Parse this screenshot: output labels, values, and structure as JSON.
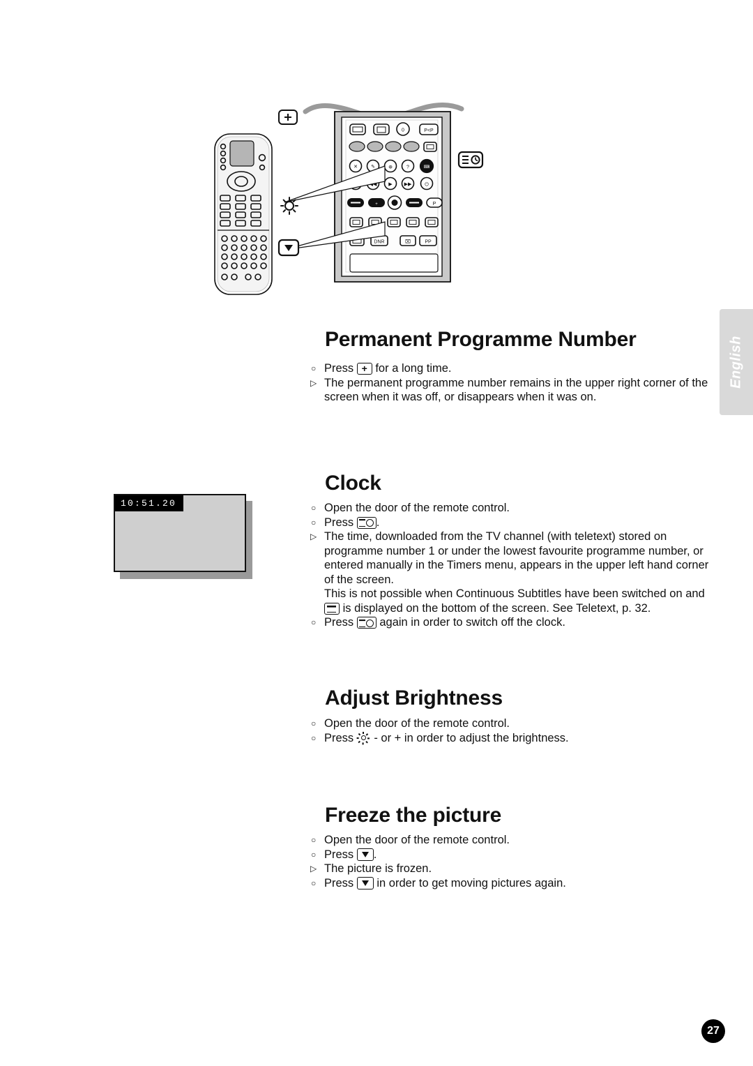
{
  "page": {
    "number": "27",
    "language_tab": "English"
  },
  "illustration": {
    "alt_name": "remote-control-diagram",
    "callouts": {
      "plus_key": "+",
      "brightness_key": "brightness",
      "freeze_key": "freeze",
      "clock_key": "clock"
    },
    "remote_buttons": [
      "P+P",
      "0",
      "DNR",
      "PP",
      "P"
    ]
  },
  "clock_screen": {
    "time": "10:51.20"
  },
  "sections": [
    {
      "id": "permanent-programme-number",
      "title": "Permanent Programme Number",
      "lines": [
        {
          "bullet": "circle",
          "text_before": "Press ",
          "icon": "plus-key",
          "text_after": " for a long time."
        },
        {
          "bullet": "triangle",
          "text_before": "The permanent programme number remains in the upper right corner of the",
          "icon": "",
          "text_after": ""
        },
        {
          "bullet": "none",
          "text_before": "screen when it was off, or disappears when it was on.",
          "icon": "",
          "text_after": ""
        }
      ]
    },
    {
      "id": "clock",
      "title": "Clock",
      "lines": [
        {
          "bullet": "circle",
          "text_before": "Open the door of the remote control.",
          "icon": "",
          "text_after": ""
        },
        {
          "bullet": "circle",
          "text_before": "Press ",
          "icon": "clock-key",
          "text_after": "."
        },
        {
          "bullet": "triangle",
          "text_before": "The time, downloaded from the TV channel (with teletext) stored on",
          "icon": "",
          "text_after": ""
        },
        {
          "bullet": "none",
          "text_before": "programme number 1 or under the lowest favourite programme number, or",
          "icon": "",
          "text_after": ""
        },
        {
          "bullet": "none",
          "text_before": "entered manually in the Timers menu, appears in the upper left hand corner",
          "icon": "",
          "text_after": ""
        },
        {
          "bullet": "none",
          "text_before": "of the screen.",
          "icon": "",
          "text_after": ""
        },
        {
          "bullet": "none",
          "text_before": "This is not possible when Continuous Subtitles have been switched on and",
          "icon": "",
          "text_after": ""
        },
        {
          "bullet": "none",
          "text_before": "",
          "icon": "teletext-key",
          "text_after": " is displayed on the bottom of the screen. See Teletext, p. 32."
        },
        {
          "bullet": "circle",
          "text_before": "Press ",
          "icon": "clock-key",
          "text_after": " again in order to switch off the clock."
        }
      ]
    },
    {
      "id": "adjust-brightness",
      "title": "Adjust Brightness",
      "lines": [
        {
          "bullet": "circle",
          "text_before": "Open the door of the remote control.",
          "icon": "",
          "text_after": ""
        },
        {
          "bullet": "circle",
          "text_before": "Press ",
          "icon": "brightness-key",
          "text_after": " - or + in order to adjust the brightness."
        }
      ]
    },
    {
      "id": "freeze-the-picture",
      "title": "Freeze the picture",
      "lines": [
        {
          "bullet": "circle",
          "text_before": "Open the door of the remote control.",
          "icon": "",
          "text_after": ""
        },
        {
          "bullet": "circle",
          "text_before": "Press ",
          "icon": "freeze-key",
          "text_after": "."
        },
        {
          "bullet": "triangle",
          "text_before": "The picture is frozen.",
          "icon": "",
          "text_after": ""
        },
        {
          "bullet": "circle",
          "text_before": "Press ",
          "icon": "freeze-key",
          "text_after": " in order to get moving pictures again."
        }
      ]
    }
  ]
}
